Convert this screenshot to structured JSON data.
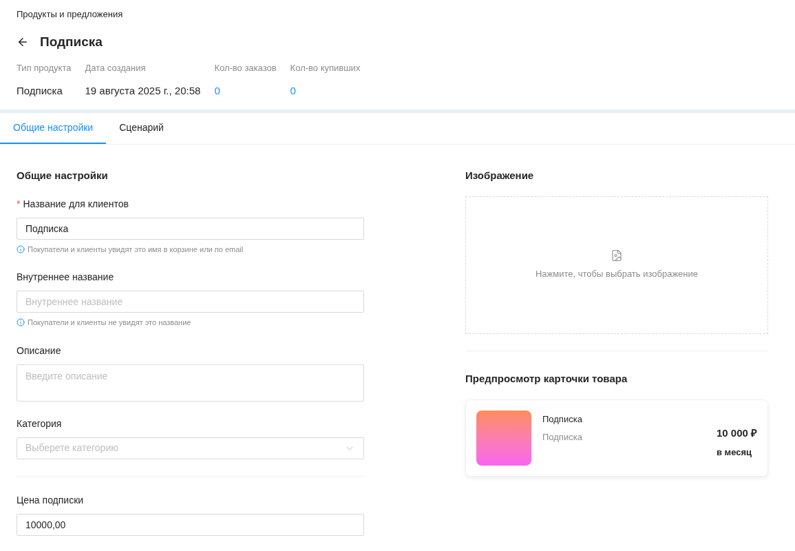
{
  "breadcrumb": "Продукты и предложения",
  "title": "Подписка",
  "stats": [
    {
      "label": "Тип продукта",
      "value": "Подписка",
      "kind": "text"
    },
    {
      "label": "Дата создания",
      "value": "19 августа 2025 г., 20:58",
      "kind": "text"
    },
    {
      "label": "Кол-во заказов",
      "value": "0",
      "kind": "link"
    },
    {
      "label": "Кол-во купивших",
      "value": "0",
      "kind": "link"
    }
  ],
  "tabs": [
    {
      "label": "Общие настройки",
      "selected": true
    },
    {
      "label": "Сценарий",
      "selected": false
    }
  ],
  "general": {
    "heading": "Общие настройки",
    "fields": [
      {
        "kind": "text",
        "label": "Название для клиентов",
        "required_mark": "*",
        "value": "Подписка",
        "hint": "Покупатели и клиенты увидят это имя в корзине или по email"
      },
      {
        "kind": "text",
        "label": "Внутреннее название",
        "placeholder": "Внутреннее название",
        "hint": "Покупатели и клиенты не увидят это название"
      },
      {
        "kind": "textarea",
        "label": "Описание",
        "placeholder": "Введите описание"
      },
      {
        "kind": "select",
        "label": "Категория",
        "placeholder": "Выберете категорию"
      }
    ],
    "price": {
      "label": "Цена подписки",
      "value": "10000,00"
    }
  },
  "image": {
    "heading": "Изображение",
    "prompt": "Нажмите, чтобы выбрать изображение"
  },
  "preview": {
    "heading": "Предпросмотр карточки товара",
    "name": "Подписка",
    "subtitle": "Подписка",
    "price": "10 000 ₽",
    "period": "в месяц"
  }
}
